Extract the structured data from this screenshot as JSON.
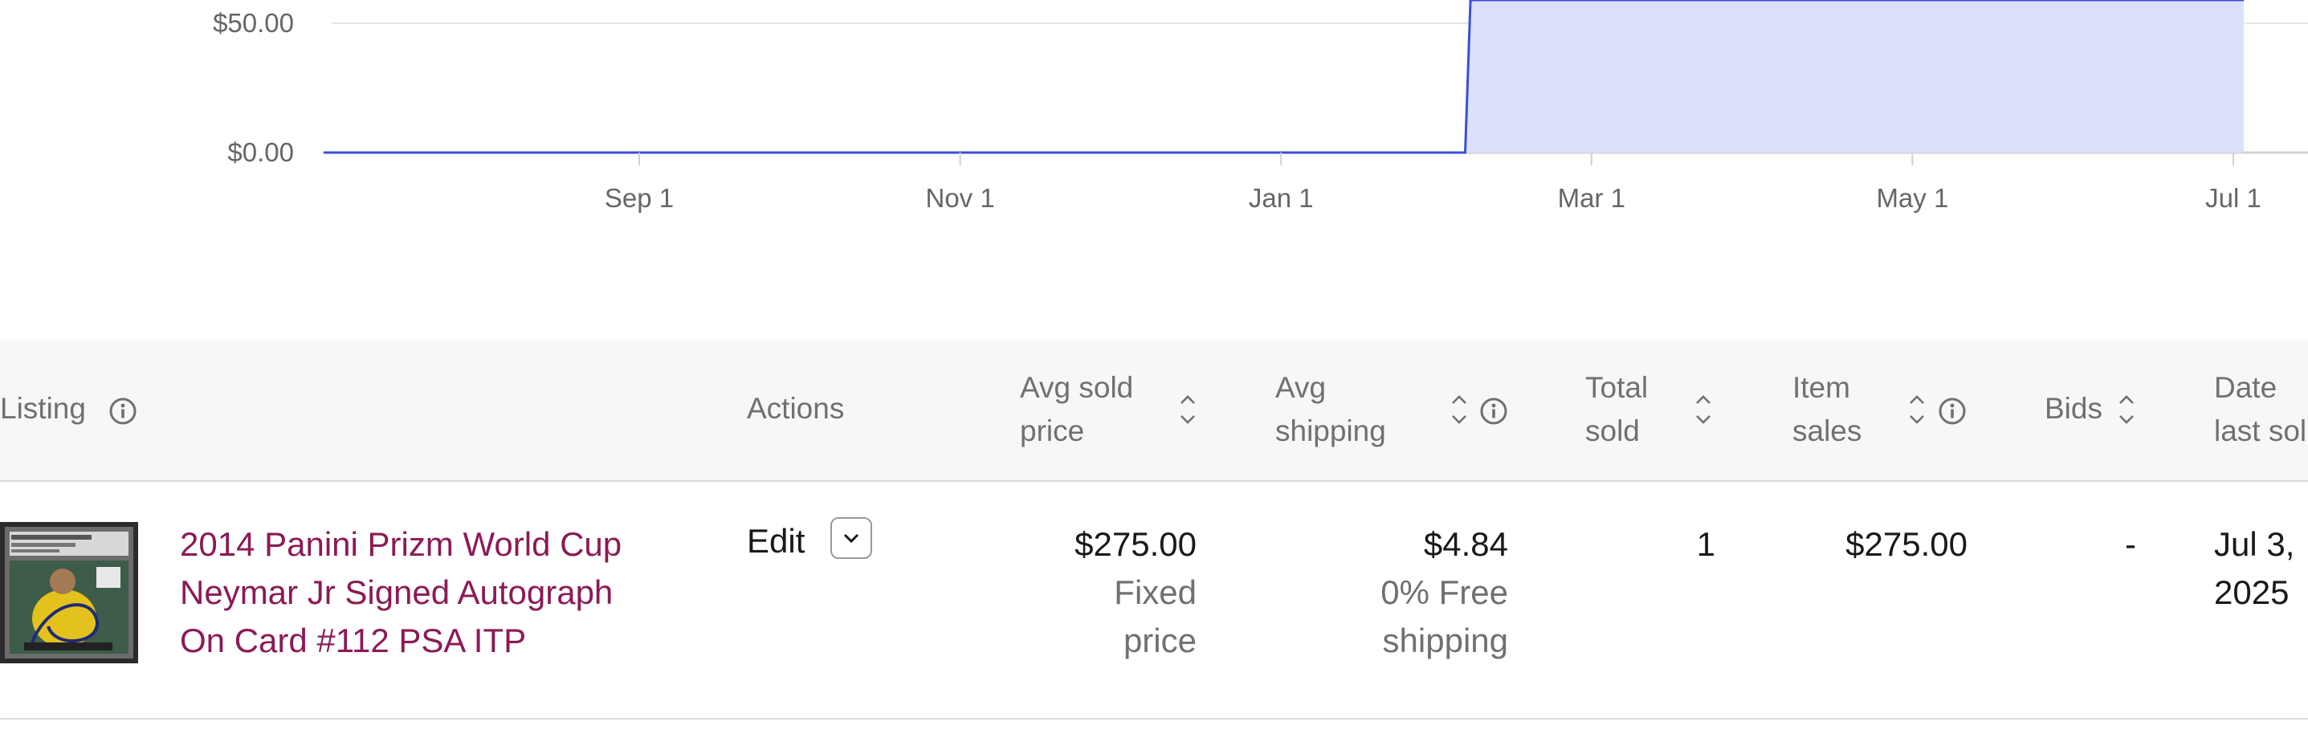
{
  "chart_data": {
    "type": "area",
    "y_ticks": [
      "$50.00",
      "$0.00"
    ],
    "y_tick_values": [
      50,
      0
    ],
    "x_ticks": [
      "Sep 1",
      "Nov 1",
      "Jan 1",
      "Mar 1",
      "May 1",
      "Jul 1"
    ],
    "x_tick_dates": [
      "2024-09-01",
      "2024-11-01",
      "2025-01-01",
      "2025-03-01",
      "2025-05-01",
      "2025-07-01"
    ],
    "series": [
      {
        "points": [
          {
            "x": "2024-07-03",
            "y": 0
          },
          {
            "x": "2025-02-05",
            "y": 0
          },
          {
            "x": "2025-02-06",
            "y": 275
          },
          {
            "x": "2025-07-03",
            "y": 275
          }
        ]
      }
    ],
    "colors": {
      "line": "#3b4fd8",
      "fill": "#dce1f9"
    },
    "grid": true
  },
  "table": {
    "headers": {
      "listing": "Listing",
      "actions": "Actions",
      "avg_sold_price": [
        "Avg sold",
        "price"
      ],
      "avg_shipping": [
        "Avg",
        "shipping"
      ],
      "total_sold": [
        "Total",
        "sold"
      ],
      "item_sales": [
        "Item",
        "sales"
      ],
      "bids": "Bids",
      "date_last_sold": [
        "Date",
        "last sol"
      ]
    },
    "row": {
      "title_lines": [
        "2014 Panini Prizm World Cup",
        "Neymar Jr Signed Autograph",
        "On Card #112 PSA ITP"
      ],
      "edit_label": "Edit",
      "avg_sold_price": "$275.00",
      "format_lines": [
        "Fixed",
        "price"
      ],
      "avg_shipping": "$4.84",
      "shipping_note_lines": [
        "0% Free",
        "shipping"
      ],
      "total_sold": "1",
      "item_sales": "$275.00",
      "bids": "-",
      "date_lines": [
        "Jul 3,",
        "2025"
      ]
    }
  },
  "icons": {
    "info": "info-icon",
    "sort": "sort-toggle-icon",
    "dropdown": "chevron-down-icon"
  }
}
